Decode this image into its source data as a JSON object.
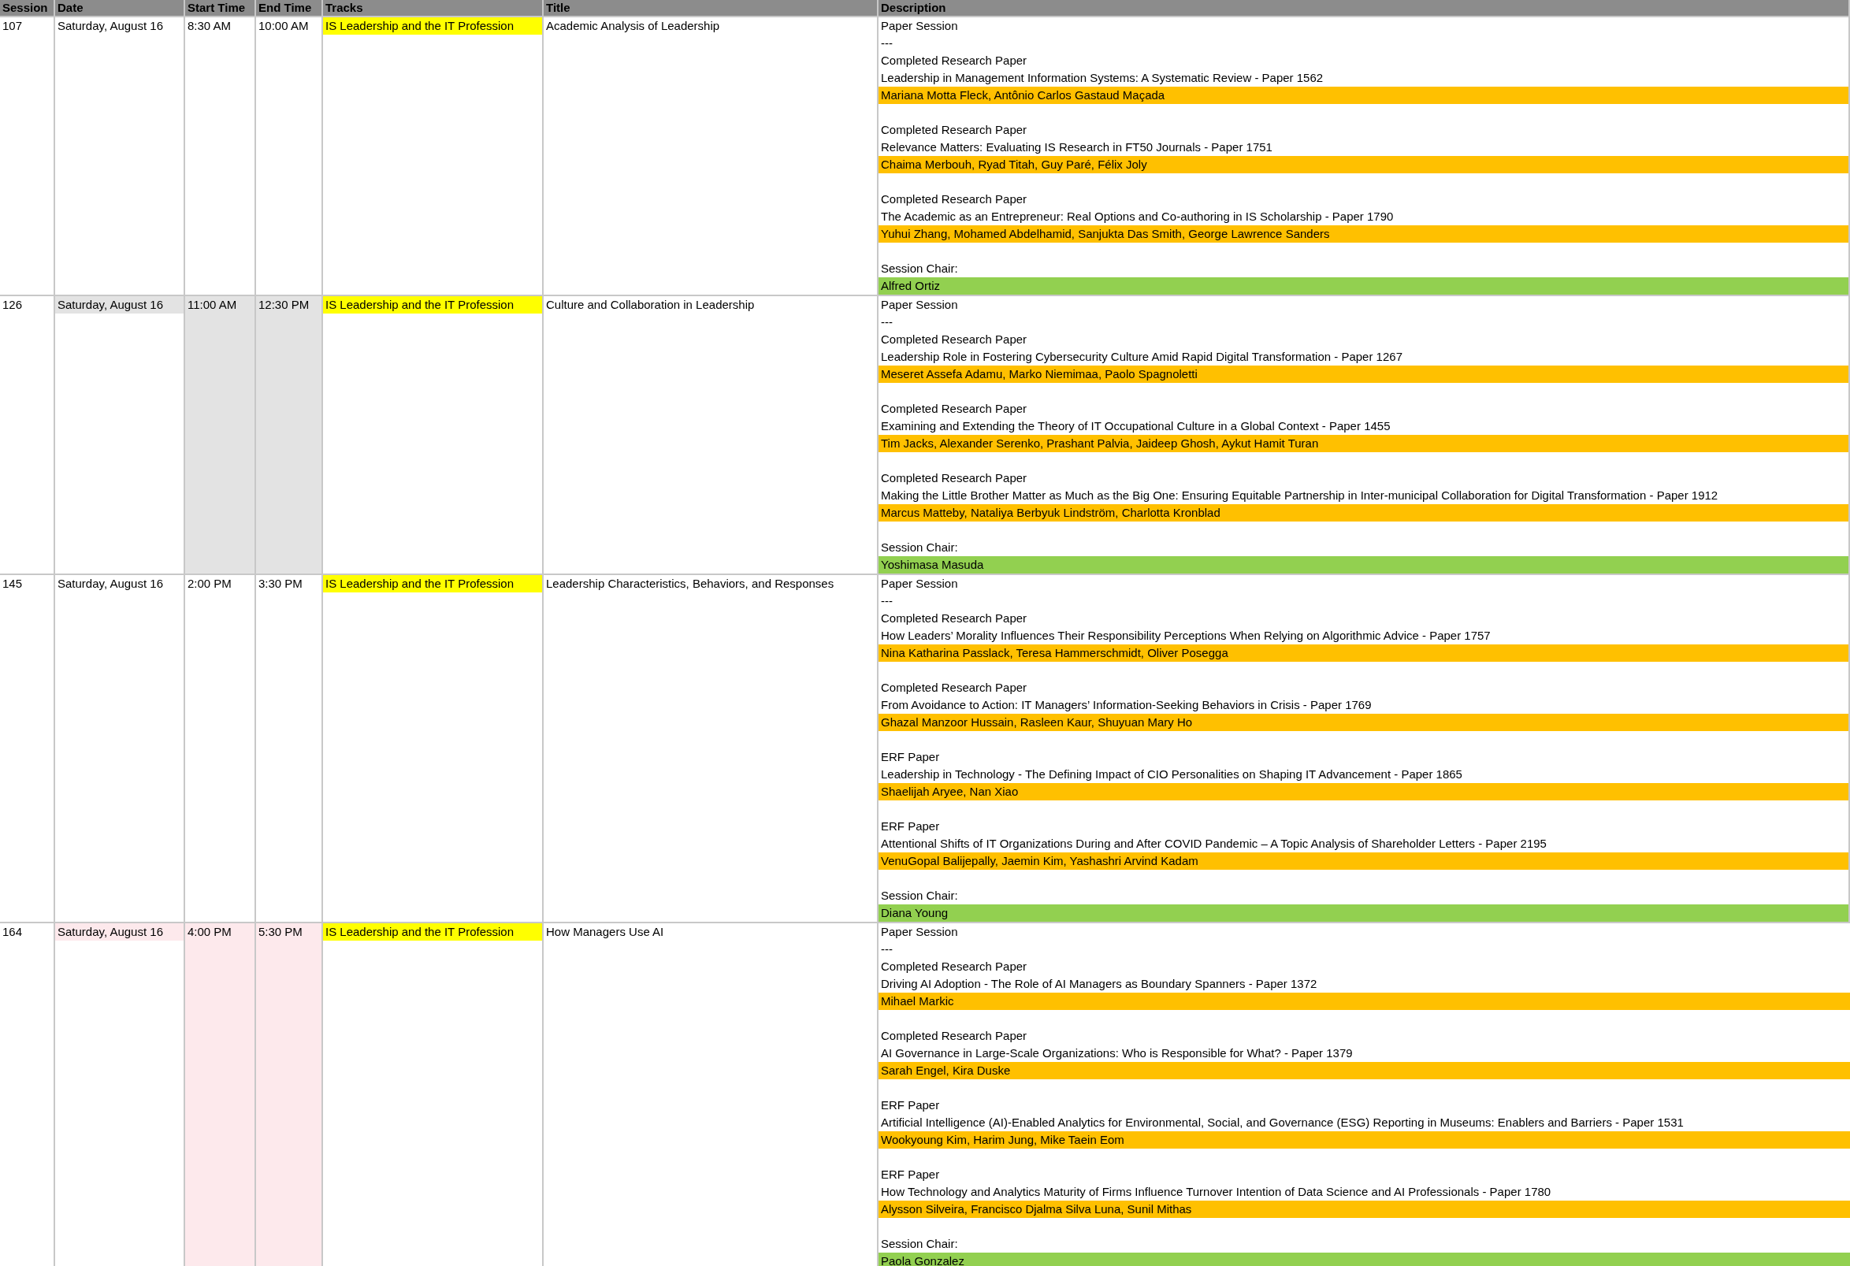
{
  "columns": [
    "Session",
    "Date",
    "Start Time",
    "End Time",
    "Tracks",
    "Title",
    "Description"
  ],
  "sessions": [
    {
      "session": "107",
      "date": "Saturday, August 16",
      "start_time": "8:30 AM",
      "end_time": "10:00 AM",
      "track": "IS Leadership and the IT Profession",
      "title": "Academic Analysis of Leadership",
      "description": {
        "session_type": "Paper Session",
        "separator": "---",
        "papers": [
          {
            "paper_type": "Completed Research Paper",
            "title": "Leadership in Management Information Systems: A Systematic Review - Paper 1562",
            "authors": "Mariana Motta Fleck, Antônio Carlos Gastaud Maçada"
          },
          {
            "paper_type": "Completed Research Paper",
            "title": "Relevance Matters: Evaluating IS Research in FT50 Journals - Paper 1751",
            "authors": "Chaima Merbouh, Ryad Titah, Guy Paré, Félix Joly"
          },
          {
            "paper_type": "Completed Research Paper",
            "title": "The Academic as an Entrepreneur: Real Options and Co-authoring in IS Scholarship - Paper 1790",
            "authors": "Yuhui Zhang, Mohamed Abdelhamid, Sanjukta Das Smith, George Lawrence Sanders"
          }
        ],
        "chair_label": "Session Chair:",
        "chair": "Alfred Ortiz"
      }
    },
    {
      "session": "126",
      "color": "#e3e3e3",
      "date": "Saturday, August 16",
      "start_time": "11:00 AM",
      "end_time": "12:30 PM",
      "track": "IS Leadership and the IT Profession",
      "title": "Culture and Collaboration in Leadership",
      "description": {
        "session_type": "Paper Session",
        "separator": "---",
        "papers": [
          {
            "paper_type": "Completed Research Paper",
            "title": "Leadership Role in Fostering Cybersecurity Culture Amid Rapid Digital Transformation - Paper 1267",
            "authors": "Meseret Assefa Adamu, Marko Niemimaa, Paolo Spagnoletti"
          },
          {
            "paper_type": "Completed Research Paper",
            "title": "Examining and Extending the Theory of IT Occupational Culture in a Global Context - Paper 1455",
            "authors": "Tim Jacks, Alexander Serenko, Prashant Palvia, Jaideep Ghosh, Aykut Hamit Turan"
          },
          {
            "paper_type": "Completed Research Paper",
            "title": "Making the Little Brother Matter as Much as the Big One: Ensuring Equitable Partnership in Inter-municipal Collaboration for Digital Transformation - Paper 1912",
            "authors": "Marcus Matteby, Nataliya Berbyuk Lindström, Charlotta Kronblad"
          }
        ],
        "chair_label": "Session Chair:",
        "chair": "Yoshimasa Masuda"
      }
    },
    {
      "session": "145",
      "date": "Saturday, August 16",
      "start_time": "2:00 PM",
      "end_time": "3:30 PM",
      "track": "IS Leadership and the IT Profession",
      "title": "Leadership Characteristics, Behaviors, and Responses",
      "description": {
        "session_type": "Paper Session",
        "separator": "---",
        "papers": [
          {
            "paper_type": "Completed Research Paper",
            "title": "How Leaders’ Morality Influences Their Responsibility Perceptions When Relying on Algorithmic Advice - Paper 1757",
            "authors": "Nina Katharina Passlack, Teresa Hammerschmidt, Oliver Posegga"
          },
          {
            "paper_type": "Completed Research Paper",
            "title": "From Avoidance to Action: IT Managers’ Information-Seeking Behaviors in Crisis - Paper 1769",
            "authors": "Ghazal Manzoor Hussain, Rasleen Kaur, Shuyuan Mary Ho"
          },
          {
            "paper_type": "ERF Paper",
            "title": "Leadership in Technology - The Defining Impact of CIO Personalities on Shaping IT Advancement - Paper 1865",
            "authors": "Shaelijah Aryee, Nan Xiao"
          },
          {
            "paper_type": "ERF Paper",
            "title": "Attentional Shifts of IT Organizations During and After COVID Pandemic – A Topic Analysis of Shareholder Letters - Paper 2195",
            "authors": "VenuGopal Balijepally, Jaemin Kim, Yashashri Arvind Kadam"
          }
        ],
        "chair_label": "Session Chair:",
        "chair": "Diana Young"
      }
    },
    {
      "session": "164",
      "color": "#fde9ec",
      "date": "Saturday, August 16",
      "start_time": "4:00 PM",
      "end_time": "5:30 PM",
      "track": "IS Leadership and the IT Profession",
      "title": "How Managers Use AI",
      "description": {
        "session_type": "Paper Session",
        "separator": "---",
        "papers": [
          {
            "paper_type": "Completed Research Paper",
            "title": "Driving AI Adoption - The Role of AI Managers as Boundary Spanners - Paper 1372",
            "authors": "Mihael Markic"
          },
          {
            "paper_type": "Completed Research Paper",
            "title": "AI Governance in Large-Scale Organizations: Who is Responsible for What? - Paper 1379",
            "authors": "Sarah Engel, Kira Duske"
          },
          {
            "paper_type": "ERF Paper",
            "title": "Artificial Intelligence (AI)-Enabled Analytics for Environmental, Social, and Governance (ESG) Reporting in Museums: Enablers and Barriers - Paper 1531",
            "authors": "Wookyoung Kim, Harim Jung, Mike Taein Eom"
          },
          {
            "paper_type": "ERF Paper",
            "title": "How Technology and Analytics Maturity of Firms Influence Turnover Intention of Data Science and AI Professionals - Paper 1780",
            "authors": "Alysson Silveira, Francisco Djalma Silva Luna, Sunil Mithas"
          }
        ],
        "chair_label": "Session Chair:",
        "chair": "Paola Gonzalez"
      }
    }
  ]
}
